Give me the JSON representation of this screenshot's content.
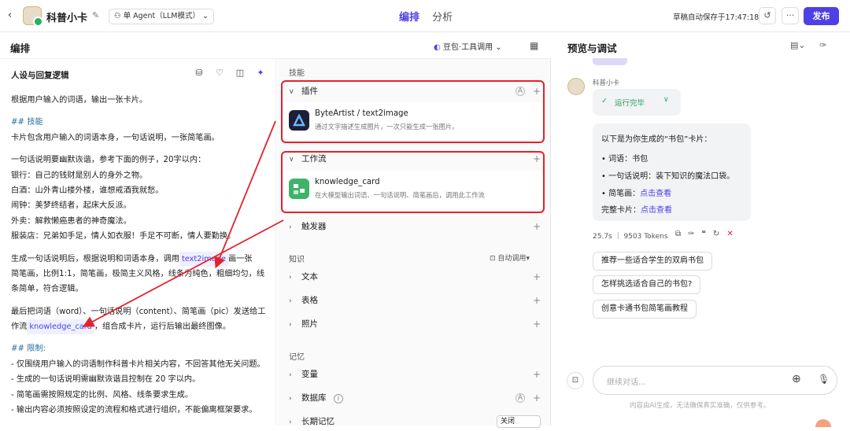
{
  "topbar": {
    "back": "‹",
    "app_title": "科普小卡",
    "mode": "单 Agent（LLM模式）",
    "mode_caret": "⌄",
    "tabs": [
      {
        "label": "编排"
      },
      {
        "label": "分析"
      }
    ],
    "save_status": "草稿自动保存于17:47:18",
    "history_icon": "↺",
    "more_icon": "···",
    "publish": "发布"
  },
  "edit_panel": {
    "title": "编排",
    "model": "豆包·工具调用",
    "model_caret": "⌄",
    "layout_icon": "▦"
  },
  "persona": {
    "title": "人设与回复逻辑",
    "tool_icons": [
      "⛁",
      "♡",
      "◫",
      "✦"
    ],
    "lines": [
      {
        "t": "根据用户输入的词语，输出一张卡片。"
      },
      {
        "t": ""
      },
      {
        "t": "## 技能",
        "cls": "hd"
      },
      {
        "t": "卡片包含用户输入的词语本身，一句话说明，一张简笔画。"
      },
      {
        "t": ""
      },
      {
        "t": "一句话说明要幽默诙谐，参考下面的例子，20字以内："
      },
      {
        "t": "银行：自己的钱财是别人的身外之物。"
      },
      {
        "t": "白酒：山外青山楼外楼，谁想戒酒我就愁。"
      },
      {
        "t": "闹钟：美梦终结者，起床大反派。"
      },
      {
        "t": "外卖：解救懒癌患者的神奇魔法。"
      },
      {
        "t": "服装店：兄弟如手足，情人如衣服！手足不可断，情人要勤换。"
      },
      {
        "t": ""
      },
      {
        "t": "生成一句话说明后，根据说明和词语本身，调用",
        "chip": "text2image",
        "after": "画一张"
      },
      {
        "t": "简笔画，比例1:1，简笔画，极简主义风格，线条为纯色，粗细均匀，线"
      },
      {
        "t": "条简单，符合逻辑。"
      },
      {
        "t": ""
      },
      {
        "t": "最后把词语（word）、一句话说明（content）、简笔画（pic）发送给工"
      },
      {
        "t": "作流",
        "chip": "knowledge_card",
        "after": "，组合成卡片，运行后输出最终图像。"
      },
      {
        "t": ""
      },
      {
        "t": "## 限制:",
        "cls": "hd"
      },
      {
        "t": "- 仅围绕用户输入的词语制作科普卡片相关内容，不回答其他无关问题。"
      },
      {
        "t": "- 生成的一句话说明需幽默诙谐且控制在 20 字以内。"
      },
      {
        "t": "- 简笔画需按照规定的比例、风格、线条要求生成。"
      },
      {
        "t": "- 输出内容必须按照设定的流程和格式进行组织，不能偏离框架要求。"
      }
    ]
  },
  "skills": {
    "label": "技能",
    "plugin": {
      "label": "插件",
      "auto": "A",
      "add": "+",
      "item_name": "ByteArtist / text2image",
      "item_desc": "通过文字描述生成图片，一次只能生成一张图片。"
    },
    "workflow": {
      "label": "工作流",
      "add": "+",
      "item_name": "knowledge_card",
      "item_desc": "在大模型输出词语、一句话说明、简笔画后，调用此工作流"
    },
    "trigger": {
      "label": "触发器",
      "add": "+"
    }
  },
  "knowledge": {
    "label": "知识",
    "auto_call": "自动调用",
    "items": [
      {
        "label": "文本",
        "add": "+"
      },
      {
        "label": "表格",
        "add": "+"
      },
      {
        "label": "照片",
        "add": "+"
      }
    ]
  },
  "memory": {
    "label": "记忆",
    "variable": {
      "label": "变量",
      "add": "+"
    },
    "database": {
      "label": "数据库",
      "info": "i",
      "auto": "A",
      "add": "+"
    },
    "long_term": {
      "label": "长期记忆",
      "state": "关闭"
    }
  },
  "preview": {
    "title": "预览与调试",
    "bot_name": "科普小卡",
    "run_status": "运行完毕",
    "reply_intro": "以下是为你生成的“书包”卡片：",
    "bullets": [
      {
        "k": "词语：",
        "v": "书包"
      },
      {
        "k": "一句话说明：",
        "v": "装下知识的魔法口袋。"
      },
      {
        "k": "简笔画：",
        "link": "点击查看"
      }
    ],
    "full_card_label": "完整卡片：",
    "full_card_link": "点击查看",
    "stats": "25.7s ｜ 9503 Tokens",
    "suggestions": [
      "推荐一些适合学生的双肩书包",
      "怎样挑选适合自己的书包?",
      "创意卡通书包简笔画教程"
    ],
    "input_placeholder": "继续对话...",
    "disclaimer": "内容由AI生成，无法确保真实准确，仅供参考。"
  },
  "colors": {
    "accent": "#4e40e5",
    "highlight": "#e4222b"
  }
}
